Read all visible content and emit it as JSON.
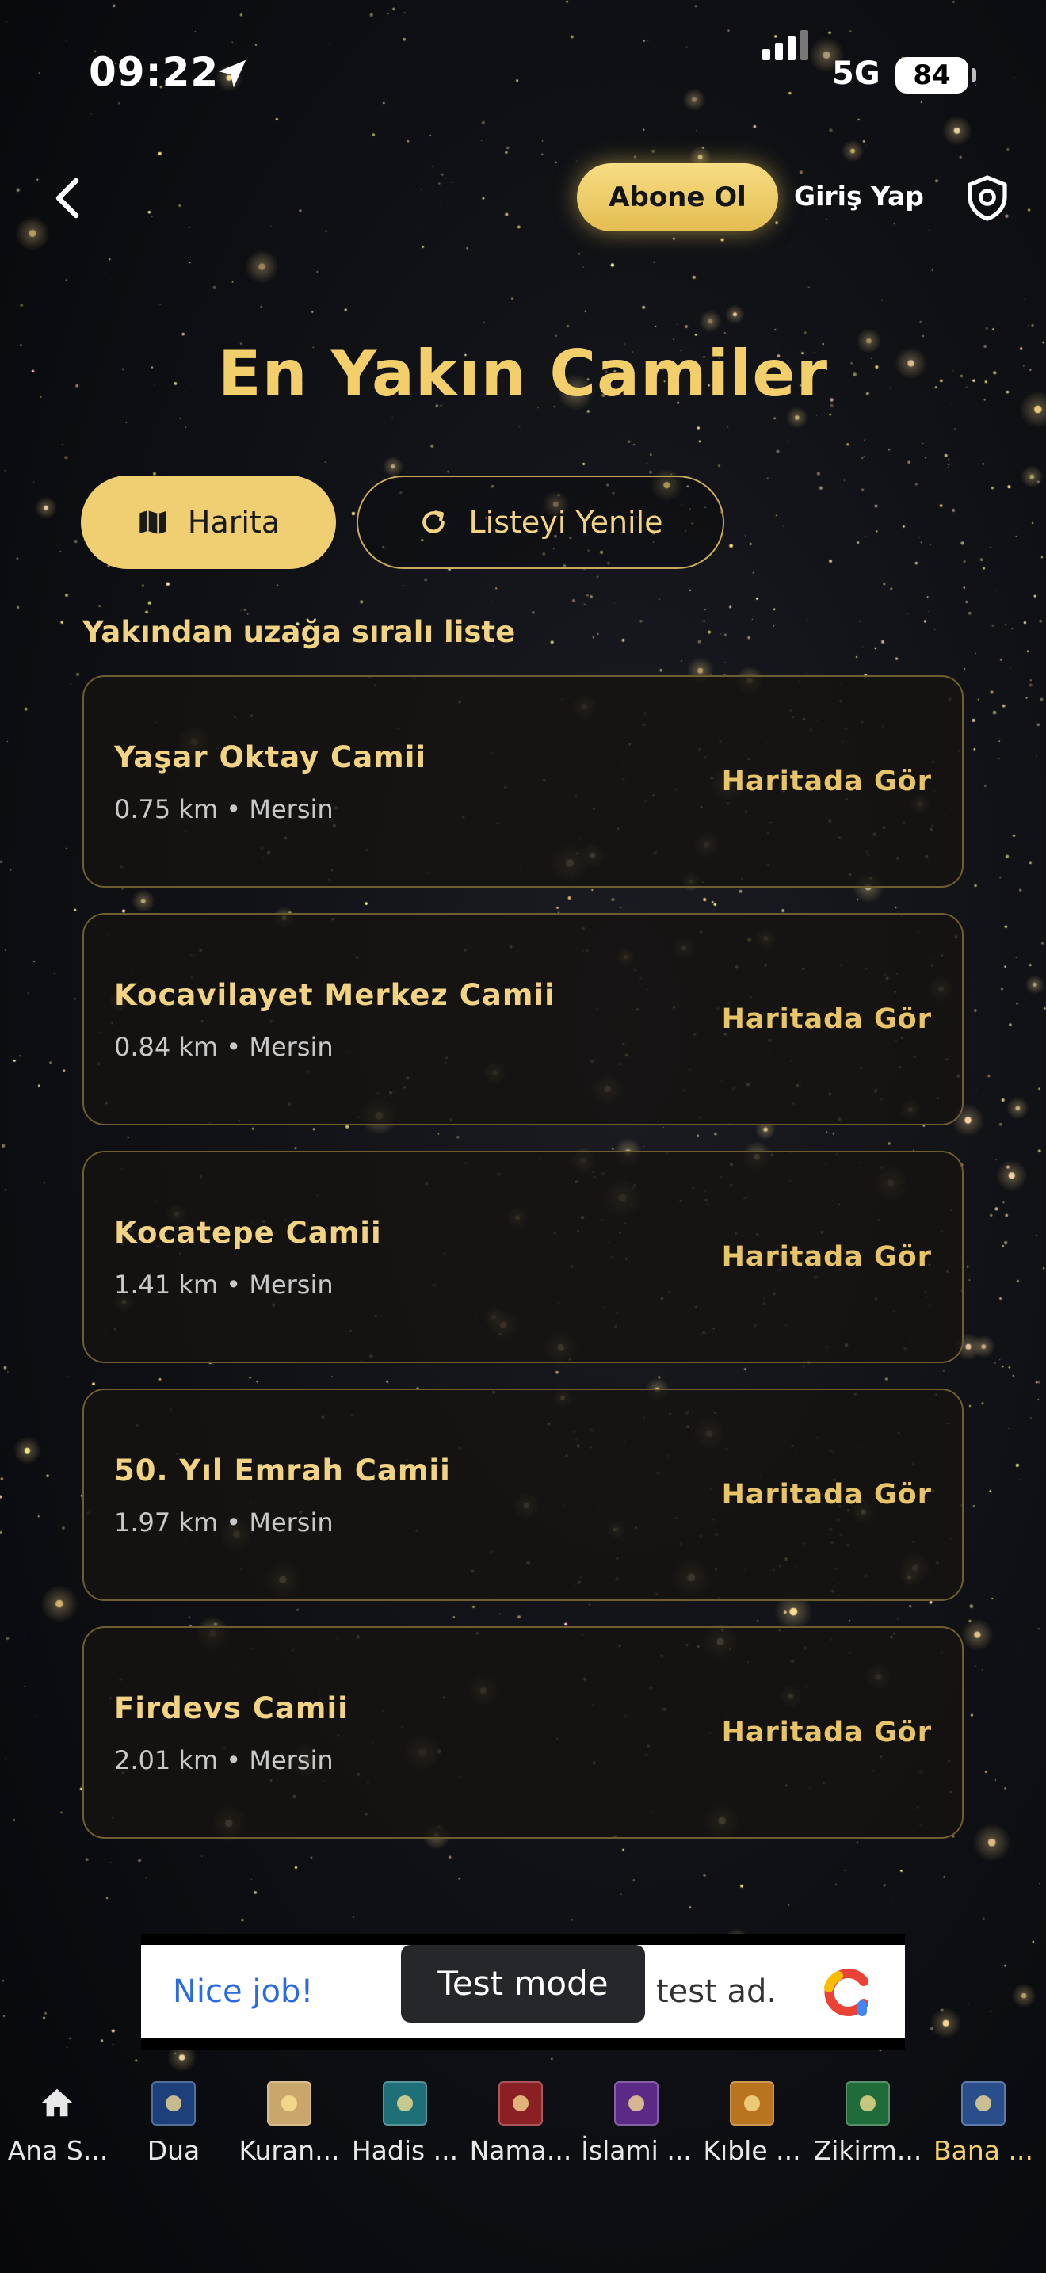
{
  "status_bar": {
    "time": "09:22",
    "network": "5G",
    "battery": "84"
  },
  "header": {
    "subscribe_label": "Abone Ol",
    "login_label": "Giriş Yap"
  },
  "page": {
    "title": "En Yakın Camiler",
    "map_button": "Harita",
    "refresh_button": "Listeyi Yenile",
    "list_caption": "Yakından uzağa sıralı liste"
  },
  "mosques": [
    {
      "name": "Yaşar Oktay Camii",
      "distance": "0.75 km",
      "city": "Mersin",
      "action": "Haritada Gör"
    },
    {
      "name": "Kocavilayet Merkez Camii",
      "distance": "0.84 km",
      "city": "Mersin",
      "action": "Haritada Gör"
    },
    {
      "name": "Kocatepe Camii",
      "distance": "1.41 km",
      "city": "Mersin",
      "action": "Haritada Gör"
    },
    {
      "name": "50. Yıl Emrah Camii",
      "distance": "1.97 km",
      "city": "Mersin",
      "action": "Haritada Gör"
    },
    {
      "name": "Firdevs Camii",
      "distance": "2.01 km",
      "city": "Mersin",
      "action": "Haritada Gör"
    }
  ],
  "ad": {
    "left_text": "Nice job!",
    "toast": "Test mode",
    "right_text": "test ad."
  },
  "tabs": [
    {
      "label": "Ana S...",
      "icon": "home-icon",
      "color": "#ffffff"
    },
    {
      "label": "Dua",
      "icon": "dua-icon",
      "color": "#1d3f7a"
    },
    {
      "label": "Kuran...",
      "icon": "quran-icon",
      "color": "#c9a66b"
    },
    {
      "label": "Hadis ...",
      "icon": "hadith-icon",
      "color": "#1f6f78"
    },
    {
      "label": "Nama...",
      "icon": "prayer-icon",
      "color": "#8a1f24"
    },
    {
      "label": "İslami ...",
      "icon": "islamic-icon",
      "color": "#5b2a86"
    },
    {
      "label": "Kıble ...",
      "icon": "qibla-icon",
      "color": "#b8741f"
    },
    {
      "label": "Zikirm...",
      "icon": "zikr-icon",
      "color": "#1f6b3a"
    },
    {
      "label": "Bana ...",
      "icon": "bana-icon",
      "color": "#2a4e8a",
      "active": true
    }
  ],
  "colors": {
    "gold": "#f2cf6b",
    "gold_button": "#f0cf72",
    "card_border": "#6e5d30"
  }
}
